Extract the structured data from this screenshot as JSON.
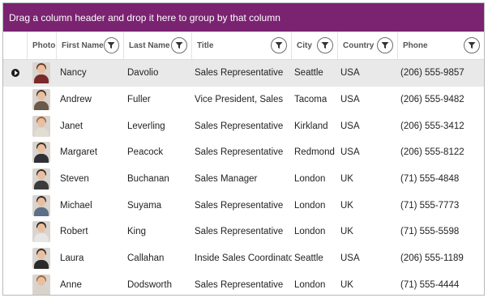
{
  "group_panel": {
    "text": "Drag a column header and drop it here to group by that column"
  },
  "columns": {
    "photo": "Photo",
    "first_name": "First Name",
    "last_name": "Last Name",
    "title": "Title",
    "city": "City",
    "country": "Country",
    "phone": "Phone"
  },
  "colors": {
    "group_panel_bg": "#7a2371",
    "selected_row_bg": "#e9e9e9"
  },
  "rows": [
    {
      "first": "Nancy",
      "last": "Davolio",
      "title": "Sales Representative",
      "city": "Seattle",
      "country": "USA",
      "phone": "(206) 555-9857",
      "hair": "#6b3a25",
      "shirt": "#7a2a2a",
      "selected": true
    },
    {
      "first": "Andrew",
      "last": "Fuller",
      "title": "Vice President, Sales",
      "city": "Tacoma",
      "country": "USA",
      "phone": "(206) 555-9482",
      "hair": "#4a3426",
      "shirt": "#6a5a4a"
    },
    {
      "first": "Janet",
      "last": "Leverling",
      "title": "Sales Representative",
      "city": "Kirkland",
      "country": "USA",
      "phone": "(206) 555-3412",
      "hair": "#a0613a",
      "shirt": "#e2dcd3"
    },
    {
      "first": "Margaret",
      "last": "Peacock",
      "title": "Sales Representative",
      "city": "Redmond",
      "country": "USA",
      "phone": "(206) 555-8122",
      "hair": "#3a2a22",
      "shirt": "#2f2f38"
    },
    {
      "first": "Steven",
      "last": "Buchanan",
      "title": "Sales Manager",
      "city": "London",
      "country": "UK",
      "phone": "(71) 555-4848",
      "hair": "#3a2a20",
      "shirt": "#3b3b3b"
    },
    {
      "first": "Michael",
      "last": "Suyama",
      "title": "Sales Representative",
      "city": "London",
      "country": "UK",
      "phone": "(71) 555-7773",
      "hair": "#2f2a26",
      "shirt": "#5d6f84"
    },
    {
      "first": "Robert",
      "last": "King",
      "title": "Sales Representative",
      "city": "London",
      "country": "UK",
      "phone": "(71) 555-5598",
      "hair": "#2b241f",
      "shirt": "#e6e6e6"
    },
    {
      "first": "Laura",
      "last": "Callahan",
      "title": "Inside Sales Coordinator",
      "city": "Seattle",
      "country": "USA",
      "phone": "(206) 555-1189",
      "hair": "#3c2a20",
      "shirt": "#2a2a2a"
    },
    {
      "first": "Anne",
      "last": "Dodsworth",
      "title": "Sales Representative",
      "city": "London",
      "country": "UK",
      "phone": "(71) 555-4444",
      "hair": "#a06a3c",
      "shirt": "#d8d2c8"
    }
  ]
}
